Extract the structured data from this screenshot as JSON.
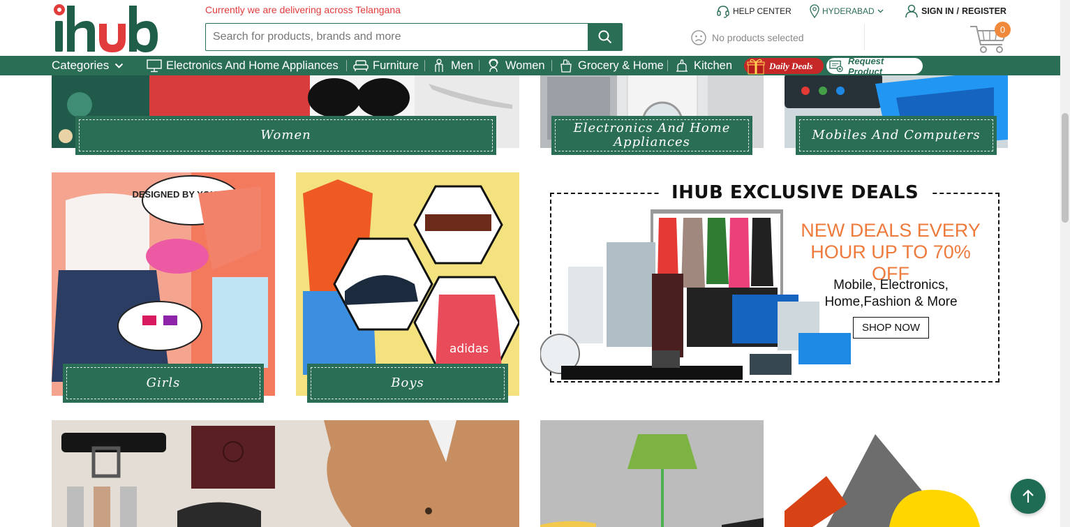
{
  "brand": {
    "logo_text": "ihub",
    "primary_color": "#2a6e56",
    "accent_color": "#f0893b",
    "alert_color": "#e23b3b"
  },
  "header": {
    "delivery_notice": "Currently we are delivering across Telangana",
    "search": {
      "placeholder": "Search for products, brands and more",
      "value": ""
    },
    "help_center": "HELP CENTER",
    "city": "HYDERABAD",
    "sign_in": "SIGN IN",
    "divider": "/",
    "register": "REGISTER",
    "compare_status": "No products selected",
    "cart_count": "0"
  },
  "nav": {
    "categories_label": "Categories",
    "items": [
      {
        "label": "Electronics And Home Appliances",
        "icon": "monitor-icon"
      },
      {
        "label": "Furniture",
        "icon": "sofa-icon"
      },
      {
        "label": "Men",
        "icon": "man-icon"
      },
      {
        "label": "Women",
        "icon": "woman-icon"
      },
      {
        "label": "Grocery & Home",
        "icon": "grocery-bag-icon"
      },
      {
        "label": "Kitchen",
        "icon": "kitchen-icon"
      }
    ],
    "daily_deals": "Daily Deals",
    "request_product": "Request Product"
  },
  "tiles": {
    "women": "Women",
    "electronics": "Electronics And Home Appliances",
    "mobiles": "Mobiles And Computers",
    "girls": "Girls",
    "boys": "Boys"
  },
  "deals": {
    "title": "IHUB EXCLUSIVE DEALS",
    "headline": "NEW DEALS EVERY HOUR UP TO 70% OFF",
    "subtext": "Mobile, Electronics, Home,Fashion & More",
    "cta": "SHOP NOW"
  },
  "illustration_text": {
    "bag_brand": "adidas",
    "shirt_print": "DESIGNED BY YOU, BY ME"
  }
}
